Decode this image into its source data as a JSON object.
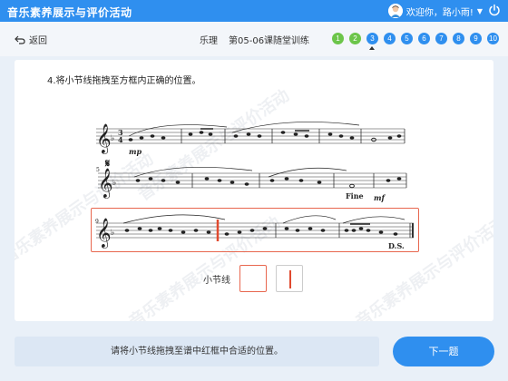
{
  "app": {
    "title": "音乐素养展示与评价活动",
    "greeting": "欢迎你，路小雨!"
  },
  "nav": {
    "back_label": "返回",
    "breadcrumb": [
      "乐理",
      "第05-06课随堂训练"
    ],
    "steps": [
      {
        "label": "1",
        "state": "done"
      },
      {
        "label": "2",
        "state": "done"
      },
      {
        "label": "3",
        "state": "current"
      },
      {
        "label": "4",
        "state": "todo"
      },
      {
        "label": "5",
        "state": "todo"
      },
      {
        "label": "6",
        "state": "todo"
      },
      {
        "label": "7",
        "state": "todo"
      },
      {
        "label": "8",
        "state": "todo"
      },
      {
        "label": "9",
        "state": "todo"
      },
      {
        "label": "10",
        "state": "todo"
      }
    ]
  },
  "question": {
    "text": "4.将小节线拖拽至方框内正确的位置。",
    "barline_label": "小节线"
  },
  "score": {
    "measure_nums": [
      "5",
      "9"
    ],
    "dynamics": [
      "mp",
      "mf"
    ],
    "marks": [
      "Fine",
      "D.S."
    ],
    "segno": "𝄋"
  },
  "footer": {
    "hint": "请将小节线拖拽至谱中红框中合适的位置。",
    "next_label": "下一题"
  },
  "colors": {
    "primary": "#2f8fef",
    "done": "#6cc54a",
    "highlight": "#e8674f",
    "barline": "#e04a2f"
  }
}
